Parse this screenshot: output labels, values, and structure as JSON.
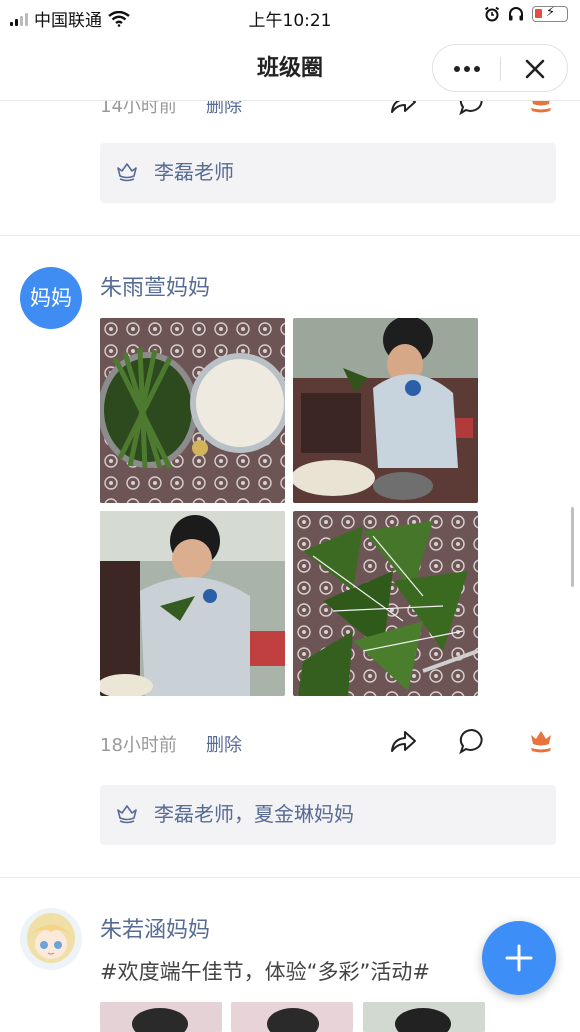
{
  "status_bar": {
    "carrier": "中国联通",
    "time": "上午10:21"
  },
  "header": {
    "title": "班级圈"
  },
  "post_prev": {
    "time": "14小时前",
    "delete_label": "删除",
    "likes": "李磊老师"
  },
  "post1": {
    "avatar_text": "妈妈",
    "author": "朱雨萱妈妈",
    "time": "18小时前",
    "delete_label": "删除",
    "likes": "李磊老师，夏金琳妈妈"
  },
  "post2": {
    "author": "朱若涵妈妈",
    "text": "#欢度端午佳节，体验“多彩”活动#"
  },
  "fab": {
    "label": "+"
  },
  "colors": {
    "accent": "#3e8ef7",
    "link": "#576b95",
    "like": "#e8743b"
  },
  "icons": [
    "share-icon",
    "comment-icon",
    "flower-icon",
    "close-icon",
    "more-icon",
    "plus-icon"
  ]
}
